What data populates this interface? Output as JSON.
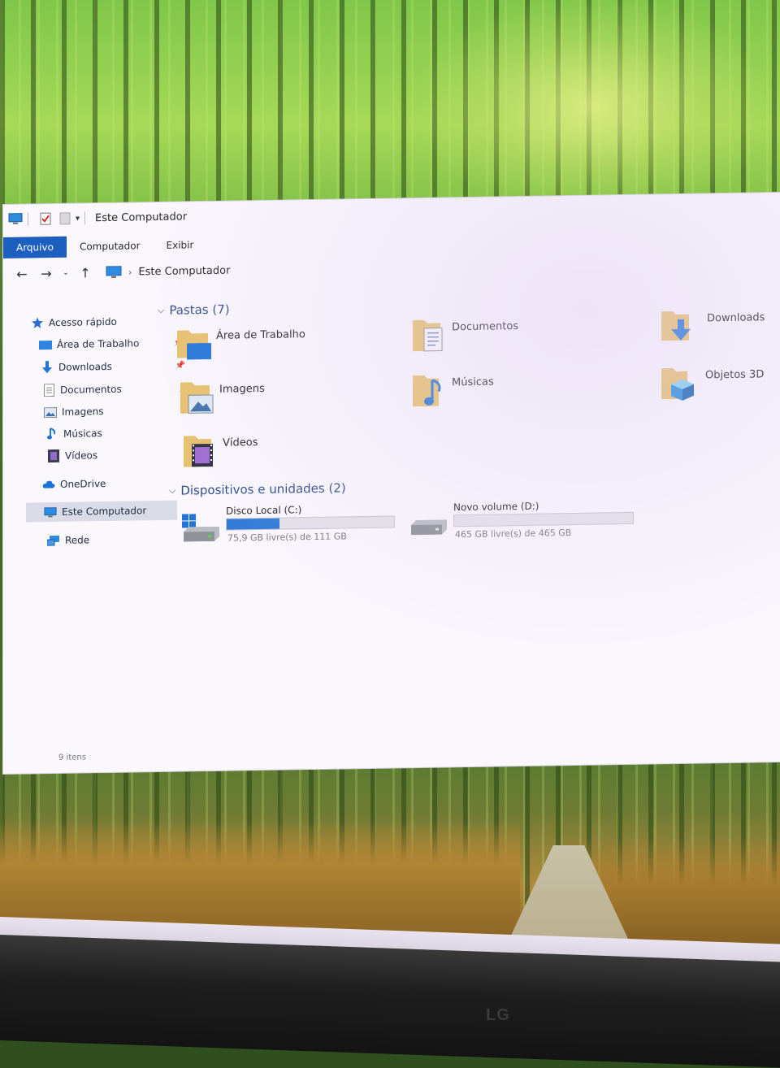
{
  "window": {
    "title": "Este Computador",
    "status_text": "9 itens"
  },
  "ribbon": {
    "tabs": [
      {
        "label": "Arquivo",
        "active": true
      },
      {
        "label": "Computador",
        "active": false
      },
      {
        "label": "Exibir",
        "active": false
      }
    ]
  },
  "address": {
    "location": "Este Computador"
  },
  "sidebar": {
    "items": [
      {
        "label": "Acesso rápido",
        "icon": "star-icon"
      },
      {
        "label": "Área de Trabalho",
        "icon": "desktop-folder-icon",
        "pinned": true
      },
      {
        "label": "Downloads",
        "icon": "download-arrow-icon",
        "pinned": true
      },
      {
        "label": "Documentos",
        "icon": "document-icon",
        "pinned": true
      },
      {
        "label": "Imagens",
        "icon": "picture-icon",
        "pinned": true
      },
      {
        "label": "Músicas",
        "icon": "music-note-icon"
      },
      {
        "label": "Vídeos",
        "icon": "video-icon"
      },
      {
        "label": "OneDrive",
        "icon": "cloud-icon"
      },
      {
        "label": "Este Computador",
        "icon": "computer-icon",
        "selected": true
      },
      {
        "label": "Rede",
        "icon": "network-icon"
      }
    ]
  },
  "folders": {
    "header": "Pastas (7)",
    "items": [
      {
        "label": "Área de Trabalho",
        "icon": "desktop-folder-icon"
      },
      {
        "label": "Documentos",
        "icon": "documents-folder-icon"
      },
      {
        "label": "Downloads",
        "icon": "downloads-folder-icon"
      },
      {
        "label": "Imagens",
        "icon": "pictures-folder-icon"
      },
      {
        "label": "Músicas",
        "icon": "music-folder-icon"
      },
      {
        "label": "Objetos 3D",
        "icon": "3d-objects-folder-icon"
      },
      {
        "label": "Vídeos",
        "icon": "videos-folder-icon"
      }
    ]
  },
  "devices": {
    "header": "Dispositivos e unidades (2)",
    "items": [
      {
        "name": "Disco Local (C:)",
        "free_text": "75,9 GB livre(s) de 111 GB",
        "used_fraction": 0.316,
        "icon": "windows-drive-icon"
      },
      {
        "name": "Novo volume (D:)",
        "free_text": "465 GB livre(s) de 465 GB",
        "used_fraction": 0.0,
        "icon": "hard-drive-icon"
      }
    ]
  },
  "monitor": {
    "brand": "LG"
  },
  "colors": {
    "accent": "#1d5fbf",
    "drive_fill": "#2a78d6",
    "folder": "#e8b84a"
  }
}
